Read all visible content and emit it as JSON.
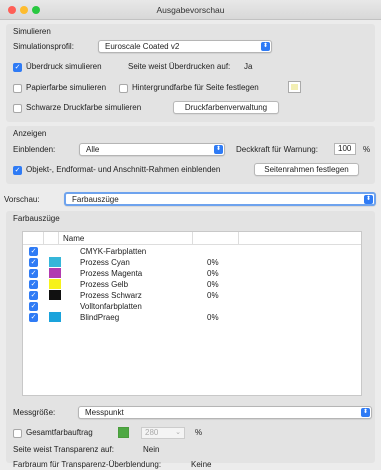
{
  "window": {
    "title": "Ausgabevorschau"
  },
  "simulate": {
    "header": "Simulieren",
    "profile_label": "Simulationsprofil:",
    "profile_value": "Euroscale Coated v2",
    "overprint_label": "Überdruck simulieren",
    "overprint_page_label": "Seite weist Überdrucken auf:",
    "overprint_page_value": "Ja",
    "paper_label": "Papierfarbe simulieren",
    "bg_label": "Hintergrundfarbe für Seite festlegen",
    "black_label": "Schwarze Druckfarbe simulieren",
    "ink_manager_button": "Druckfarbenverwaltung"
  },
  "show": {
    "header": "Anzeigen",
    "show_label": "Einblenden:",
    "show_value": "Alle",
    "opacity_label": "Deckkraft für Warnung:",
    "opacity_value": "100",
    "opacity_unit": "%",
    "boxes_label": "Objekt-, Endformat- und Anschnitt-Rahmen einblenden",
    "page_boxes_button": "Seitenrahmen festlegen"
  },
  "preview": {
    "label": "Vorschau:",
    "value": "Farbauszüge"
  },
  "separations": {
    "header": "Farbauszüge",
    "column_name": "Name",
    "rows": [
      {
        "checked": true,
        "swatch": "",
        "name": "CMYK-Farbplatten",
        "value": ""
      },
      {
        "checked": true,
        "swatch": "#35b6d9",
        "name": "Prozess Cyan",
        "value": "0%"
      },
      {
        "checked": true,
        "swatch": "#b13bb0",
        "name": "Prozess Magenta",
        "value": "0%"
      },
      {
        "checked": true,
        "swatch": "#f7f21a",
        "name": "Prozess Gelb",
        "value": "0%"
      },
      {
        "checked": true,
        "swatch": "#111111",
        "name": "Prozess Schwarz",
        "value": "0%"
      },
      {
        "checked": true,
        "swatch": "",
        "name": "Volltonfarbplatten",
        "value": ""
      },
      {
        "checked": true,
        "swatch": "#1aa3dc",
        "name": "BlindPraeg",
        "value": "0%"
      }
    ]
  },
  "footer": {
    "sample_label": "Messgröße:",
    "sample_value": "Messpunkt",
    "total_label": "Gesamtfarbauftrag",
    "total_value": "280",
    "total_unit": "%",
    "transparency_label": "Seite weist Transparenz auf:",
    "transparency_value": "Nein",
    "blend_label": "Farbraum für Transparenz-Überblendung:",
    "blend_value": "Keine"
  }
}
